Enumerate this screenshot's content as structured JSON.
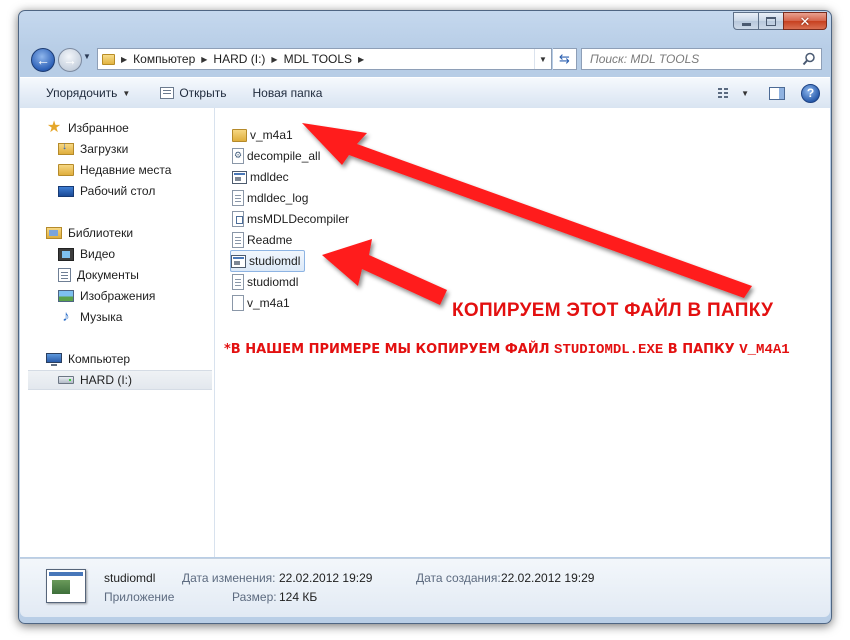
{
  "address": {
    "crumbs": [
      "Компьютер",
      "HARD (I:)",
      "MDL TOOLS"
    ]
  },
  "search": {
    "placeholder": "Поиск: MDL TOOLS"
  },
  "toolbar": {
    "organize_label": "Упорядочить",
    "open_label": "Открыть",
    "new_folder_label": "Новая папка"
  },
  "nav": {
    "favorites": {
      "title": "Избранное",
      "items": [
        "Загрузки",
        "Недавние места",
        "Рабочий стол"
      ]
    },
    "libraries": {
      "title": "Библиотеки",
      "items": [
        "Видео",
        "Документы",
        "Изображения",
        "Музыка"
      ]
    },
    "computer": {
      "title": "Компьютер",
      "items": [
        "HARD (I:)"
      ]
    }
  },
  "files": [
    {
      "name": "v_m4a1",
      "icon": "folder-icon"
    },
    {
      "name": "decompile_all",
      "icon": "batch-file-icon"
    },
    {
      "name": "mdldec",
      "icon": "application-icon"
    },
    {
      "name": "mdldec_log",
      "icon": "text-file-icon"
    },
    {
      "name": "msMDLDecompiler",
      "icon": "installer-file-icon"
    },
    {
      "name": "Readme",
      "icon": "text-file-icon"
    },
    {
      "name": "studiomdl",
      "icon": "application-icon"
    },
    {
      "name": "studiomdl",
      "icon": "text-file-icon"
    },
    {
      "name": "v_m4a1",
      "icon": "blank-file-icon"
    }
  ],
  "details": {
    "name": "studiomdl",
    "type": "Приложение",
    "modified_label": "Дата изменения:",
    "modified_value": "22.02.2012 19:29",
    "size_label": "Размер:",
    "size_value": "124 КБ",
    "created_label": "Дата создания:",
    "created_value": "22.02.2012 19:29"
  },
  "annotation": {
    "main": "КОПИРУЕМ ЭТОТ ФАЙЛ В ПАПКУ",
    "note_prefix": "*В НАШЕМ ПРИМЕРЕ МЫ КОПИРУЕМ ФАЙЛ ",
    "note_file": "STUDIOMDL.EXE",
    "note_middle": " В ПАПКУ ",
    "note_folder": "V_M4A1",
    "color": "#e31010"
  }
}
